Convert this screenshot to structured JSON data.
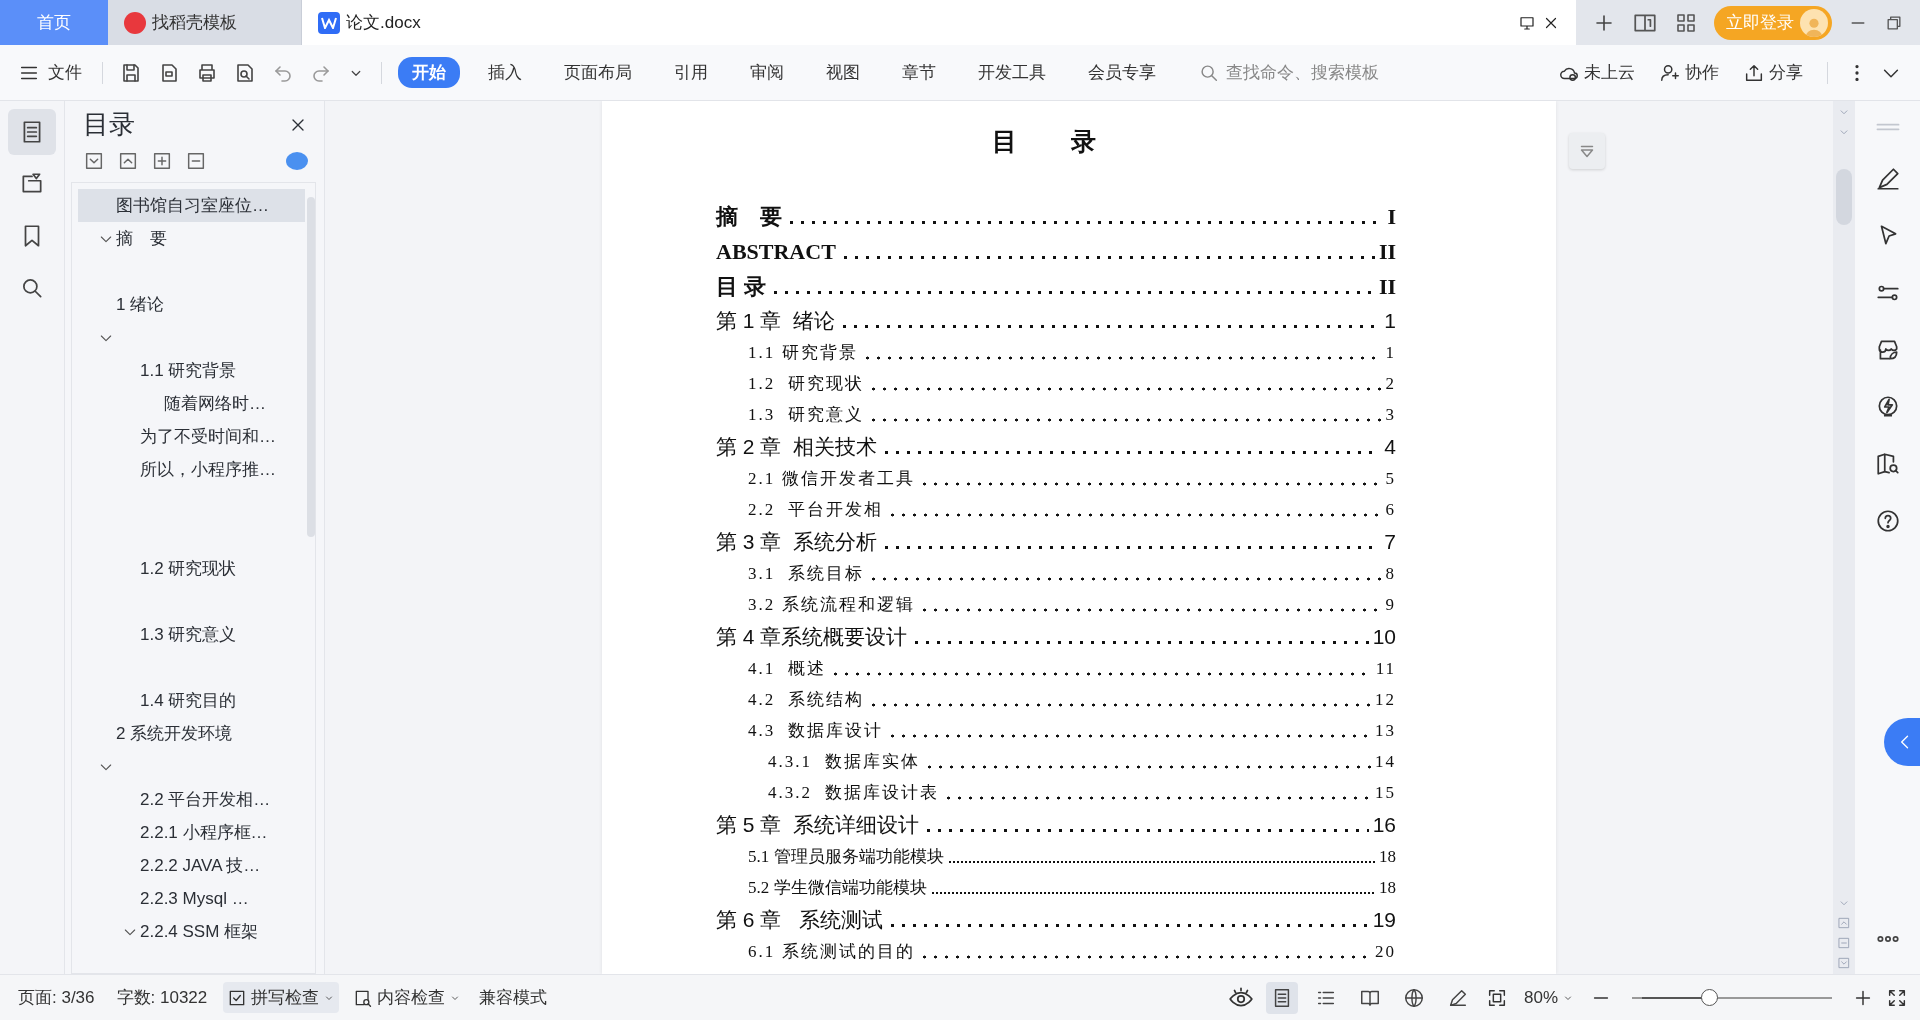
{
  "tabs": [
    {
      "kind": "home",
      "label": "首页",
      "selected": false
    },
    {
      "kind": "template",
      "label": "找稻壳模板",
      "selected": false
    },
    {
      "kind": "doc",
      "label": "论文.docx",
      "selected": true
    }
  ],
  "account": {
    "login": "立即登录"
  },
  "menu": {
    "file": "文件",
    "tabs": [
      {
        "label": "开始",
        "selected": true
      },
      {
        "label": "插入",
        "selected": false
      },
      {
        "label": "页面布局",
        "selected": false
      },
      {
        "label": "引用",
        "selected": false
      },
      {
        "label": "审阅",
        "selected": false
      },
      {
        "label": "视图",
        "selected": false
      },
      {
        "label": "章节",
        "selected": false
      },
      {
        "label": "开发工具",
        "selected": false
      },
      {
        "label": "会员专享",
        "selected": false
      }
    ],
    "search": {
      "placeholder": "查找命令、搜索模板"
    },
    "actions": [
      {
        "kind": "cloud",
        "label": "未上云"
      },
      {
        "kind": "collab",
        "label": "协作"
      },
      {
        "kind": "share",
        "label": "分享"
      }
    ]
  },
  "rail": [
    {
      "kind": "outline",
      "selected": true
    },
    {
      "kind": "navigation",
      "selected": false
    },
    {
      "kind": "bookmark",
      "selected": false
    },
    {
      "kind": "search",
      "selected": false
    }
  ],
  "sidebar": {
    "title": "目录",
    "outline": [
      {
        "label": "图书馆自习室座位…",
        "selected": true
      },
      {
        "label": "摘　要",
        "selected": false,
        "expanded": true,
        "children": [
          {
            "selected": false
          }
        ]
      },
      {
        "label": "1  绪论",
        "selected": false
      },
      {
        "selected": false,
        "expanded": true,
        "children": [
          {
            "label": "1.1 研究背景",
            "selected": false,
            "children": [
              {
                "label": "随着网络时…",
                "selected": false
              }
            ]
          },
          {
            "label": "为了不受时间和…",
            "selected": false
          },
          {
            "label": "所以，小程序推…",
            "selected": false
          },
          {
            "selected": false
          },
          {
            "selected": false
          },
          {
            "label": "1.2 研究现状",
            "selected": false
          },
          {
            "selected": false
          },
          {
            "label": "1.3  研究意义",
            "selected": false
          },
          {
            "selected": false
          },
          {
            "label": "1.4 研究目的",
            "selected": false
          }
        ]
      },
      {
        "label": "2  系统开发环境",
        "selected": false
      },
      {
        "selected": false,
        "expanded": true,
        "children": [
          {
            "label": "2.2  平台开发相…",
            "selected": false
          },
          {
            "label": "2.2.1 小程序框…",
            "selected": false
          },
          {
            "label": "2.2.2 JAVA 技…",
            "selected": false
          },
          {
            "label": "2.2.3    Mysql …",
            "selected": false
          },
          {
            "label": "2.2.4 SSM 框架",
            "selected": false,
            "expanded": true
          }
        ]
      }
    ]
  },
  "document": {
    "title": "目 录",
    "entries": [
      {
        "kind": "top",
        "label": "摘　要",
        "page": "I"
      },
      {
        "kind": "top",
        "label": "ABSTRACT",
        "page": "II"
      },
      {
        "kind": "top",
        "label": "目 录",
        "page": "II"
      },
      {
        "kind": "chapter",
        "label": "第 1 章  绪论",
        "page": "1"
      },
      {
        "kind": "section",
        "label": "1.1 研究背景",
        "page": "1"
      },
      {
        "kind": "section",
        "label": "1.2  研究现状",
        "page": "2"
      },
      {
        "kind": "section",
        "label": "1.3  研究意义",
        "page": "3"
      },
      {
        "kind": "chapter",
        "label": "第 2 章  相关技术",
        "page": "4"
      },
      {
        "kind": "section",
        "label": "2.1 微信开发者工具",
        "page": "5"
      },
      {
        "kind": "section",
        "label": "2.2  平台开发相",
        "page": "6"
      },
      {
        "kind": "chapter",
        "label": "第 3 章  系统分析",
        "page": "7"
      },
      {
        "kind": "section",
        "label": "3.1  系统目标",
        "page": "8"
      },
      {
        "kind": "section",
        "label": "3.2 系统流程和逻辑",
        "page": "9"
      },
      {
        "kind": "chapter",
        "label": "第 4 章系统概要设计",
        "page": "10"
      },
      {
        "kind": "section",
        "label": "4.1  概述",
        "page": "11"
      },
      {
        "kind": "section",
        "label": "4.2  系统结构",
        "page": "12"
      },
      {
        "kind": "section",
        "label": "4.3  数据库设计",
        "page": "13"
      },
      {
        "kind": "subsection",
        "label": "4.3.1  数据库实体",
        "page": "14"
      },
      {
        "kind": "subsection",
        "label": "4.3.2  数据库设计表",
        "page": "15"
      },
      {
        "kind": "chapter",
        "label": "第 5 章  系统详细设计",
        "page": "16"
      },
      {
        "kind": "dense",
        "label": "5.1 管理员服务端功能模块",
        "page": "18"
      },
      {
        "kind": "dense",
        "label": "5.2 学生微信端功能模块",
        "page": "18"
      },
      {
        "kind": "chapter",
        "label": "第 6 章   系统测试",
        "page": "19"
      },
      {
        "kind": "section",
        "label": "6.1 系统测试的目的",
        "page": "20"
      }
    ]
  },
  "status_bar": {
    "page": "页面: 3/36",
    "words": "字数: 10322",
    "spell_check": "拼写检查",
    "content_check": "内容检查",
    "mode": "兼容模式",
    "zoom": "80%",
    "views": [
      {
        "kind": "page",
        "selected": true
      },
      {
        "kind": "outline",
        "selected": false
      },
      {
        "kind": "read",
        "selected": false
      },
      {
        "kind": "web",
        "selected": false
      },
      {
        "kind": "write",
        "selected": false
      }
    ],
    "zoom_slider": {
      "level": 0.38
    }
  }
}
